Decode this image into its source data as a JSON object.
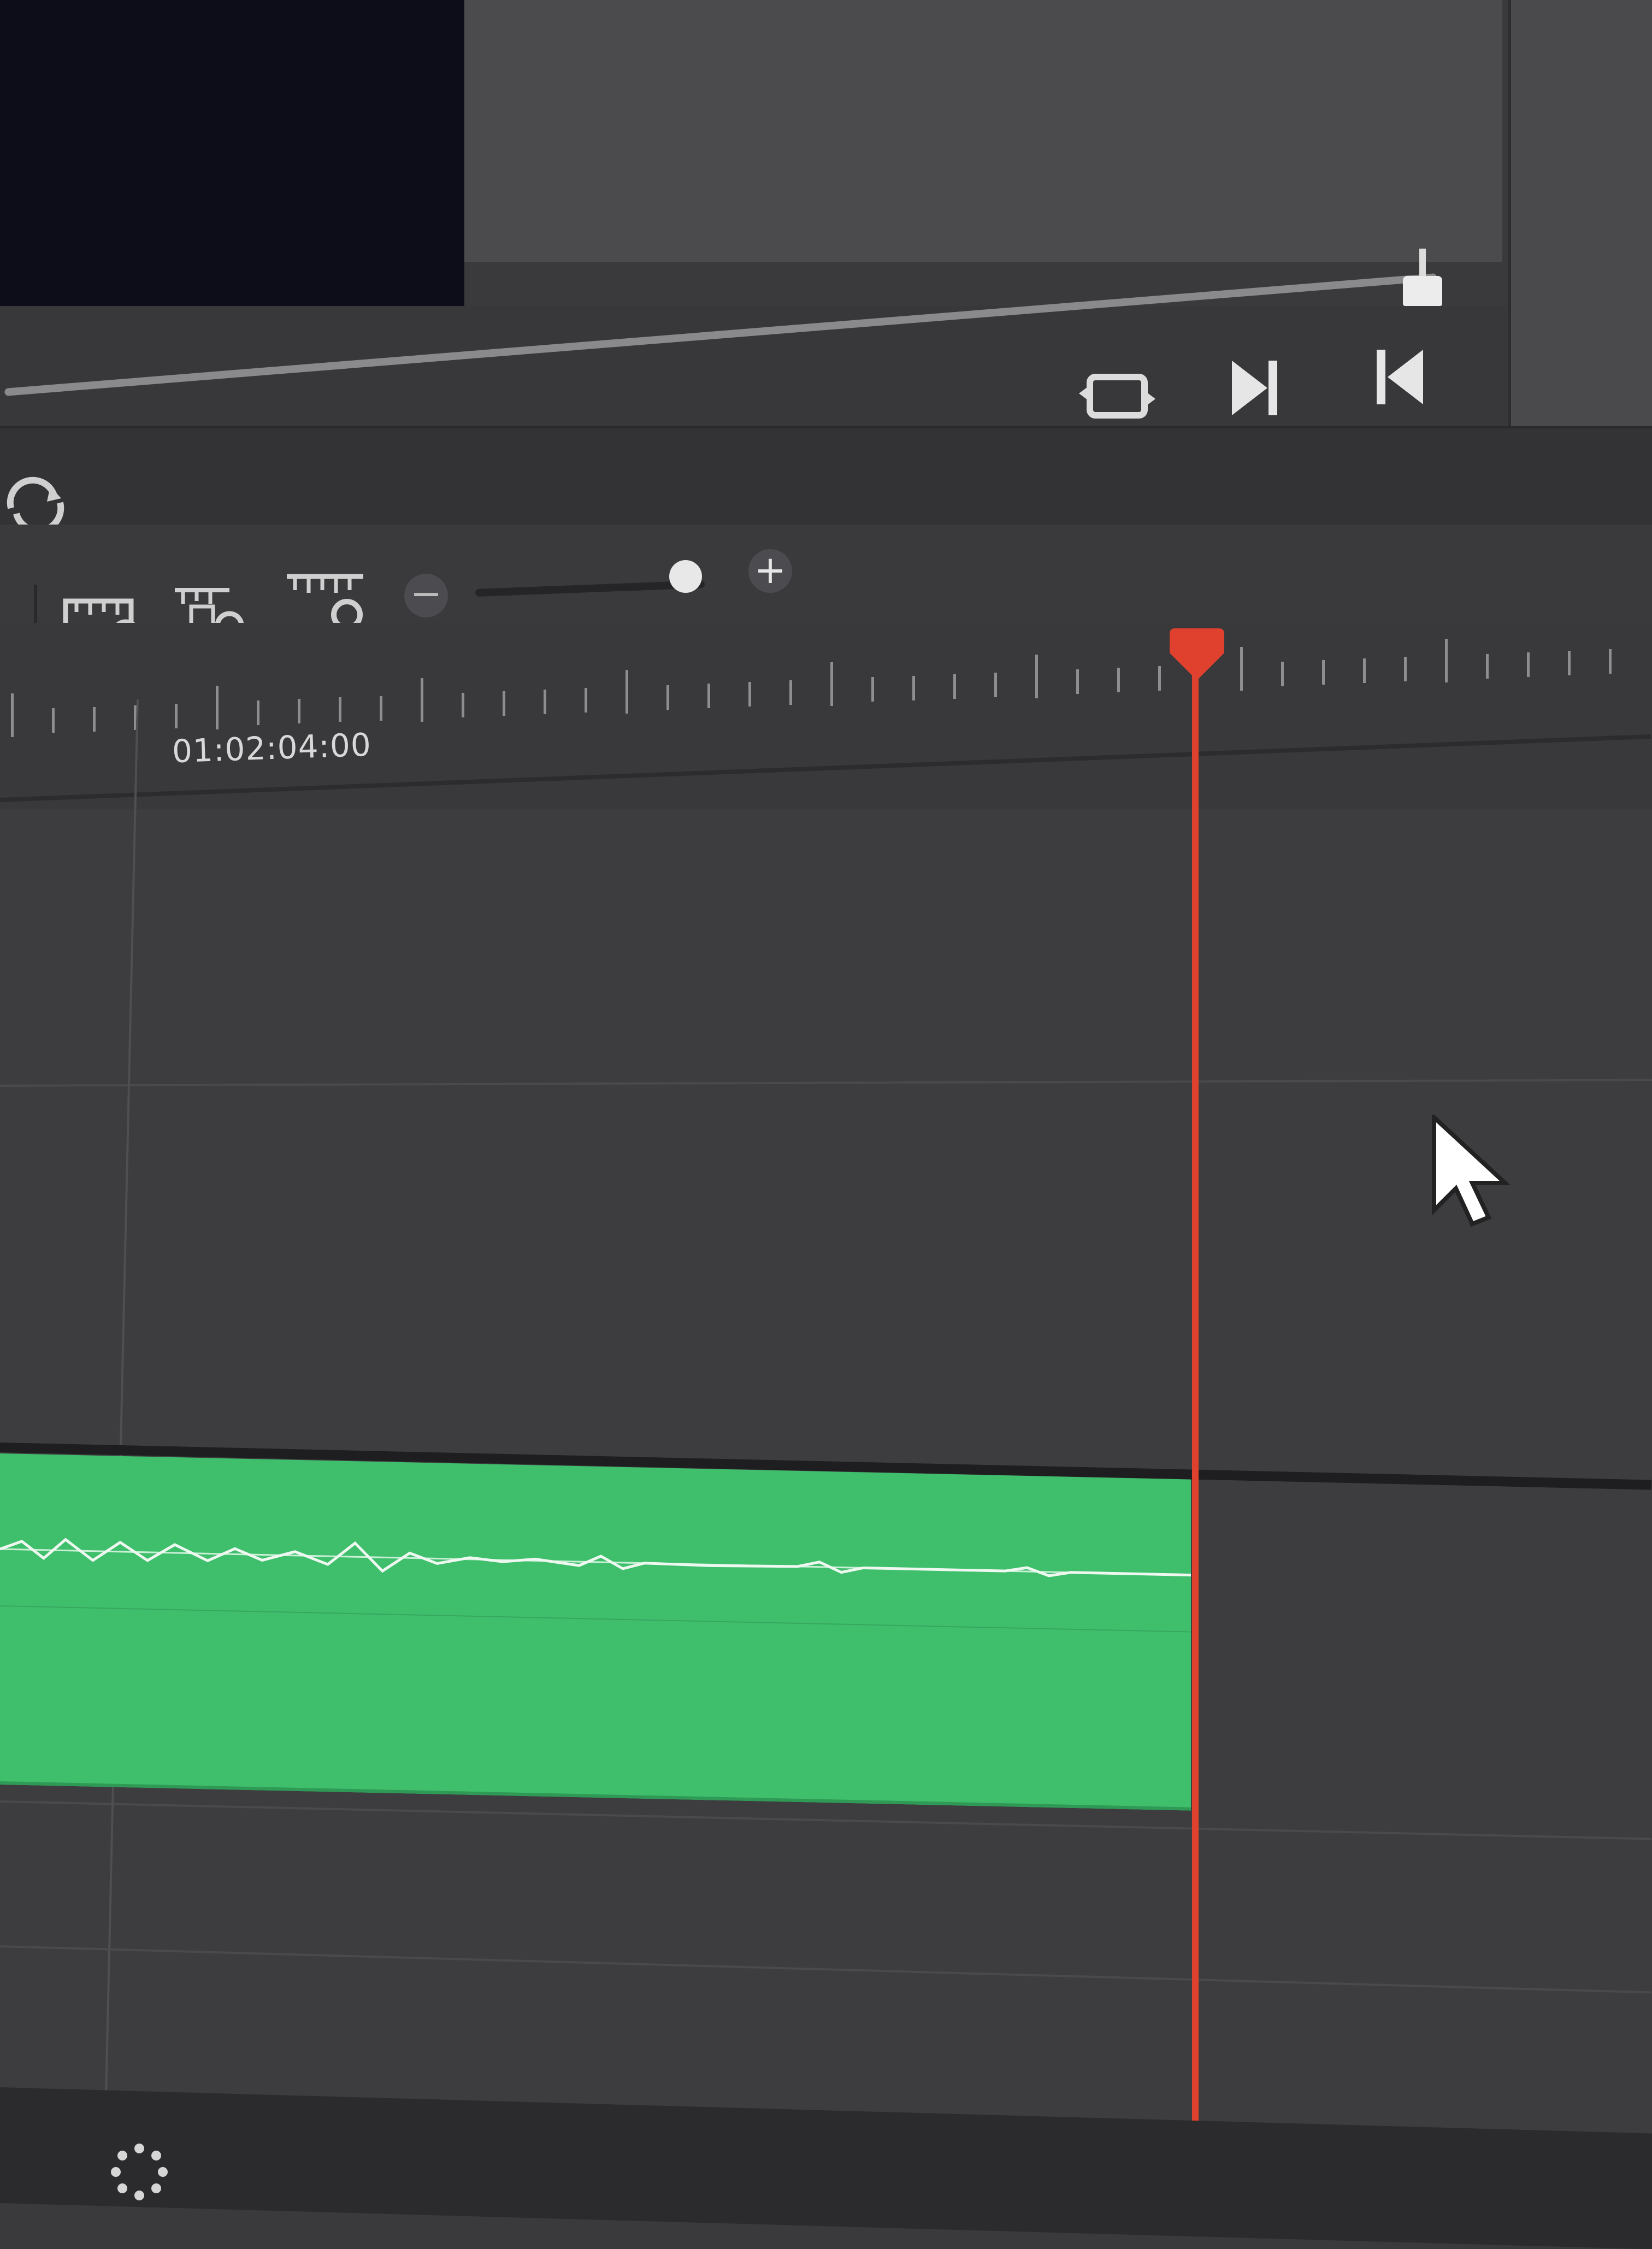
{
  "viewer": {
    "scrubber_progress": 1.0
  },
  "transport": {
    "buttons": [
      {
        "name": "loop-clip-icon"
      },
      {
        "name": "next-clip-icon"
      },
      {
        "name": "previous-clip-icon"
      }
    ]
  },
  "timeline": {
    "loop_icon": "loop-icon",
    "timecode_label": "01:02:04:00",
    "zoom": {
      "minus": "−",
      "plus": "+",
      "level": 1.0
    },
    "toolbar_icons": [
      "zoom-full-icon",
      "zoom-detail-icon",
      "zoom-custom-icon"
    ]
  },
  "colors": {
    "playhead": "#e0412e",
    "audio_clip": "#3fbf6c",
    "background": "#3a3a3d"
  }
}
